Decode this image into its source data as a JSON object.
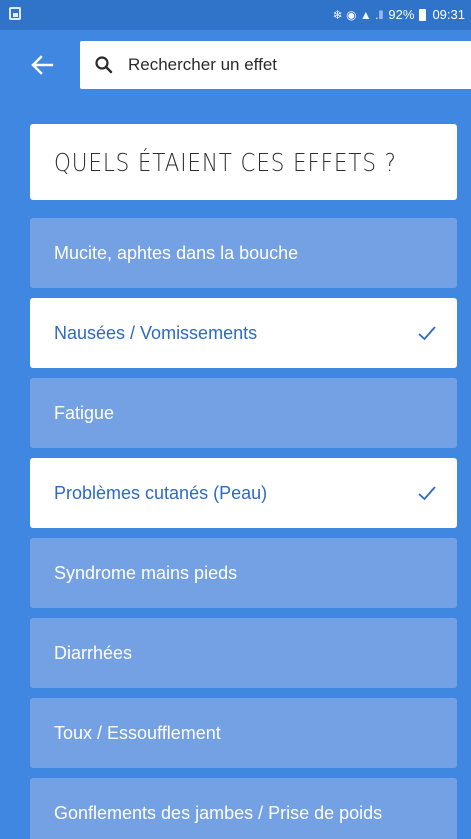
{
  "status_bar": {
    "signal_icons": "❄ ◉ ▲ .‖",
    "battery": "92%",
    "time": "09:31"
  },
  "search": {
    "placeholder": "Rechercher un effet",
    "value": ""
  },
  "question": {
    "title": "QUELS ÉTAIENT CES EFFETS ?"
  },
  "effects": [
    {
      "label": "Mucite, aphtes dans la bouche",
      "selected": false
    },
    {
      "label": "Nausées / Vomissements",
      "selected": true
    },
    {
      "label": "Fatigue",
      "selected": false
    },
    {
      "label": "Problèmes cutanés (Peau)",
      "selected": true
    },
    {
      "label": "Syndrome mains pieds",
      "selected": false
    },
    {
      "label": "Diarrhées",
      "selected": false
    },
    {
      "label": "Toux / Essoufflement",
      "selected": false
    },
    {
      "label": "Gonflements des jambes / Prise de poids",
      "selected": false
    }
  ],
  "colors": {
    "background": "#3f87e1",
    "status_bar": "#2f74c9",
    "item_unselected": "#74a1e3",
    "item_selected": "#ffffff",
    "selected_text": "#2c6ac6"
  },
  "icons": {
    "back": "arrow-left-icon",
    "search": "search-icon",
    "check": "check-icon",
    "gallery": "gallery-notification-icon",
    "battery": "battery-icon"
  }
}
